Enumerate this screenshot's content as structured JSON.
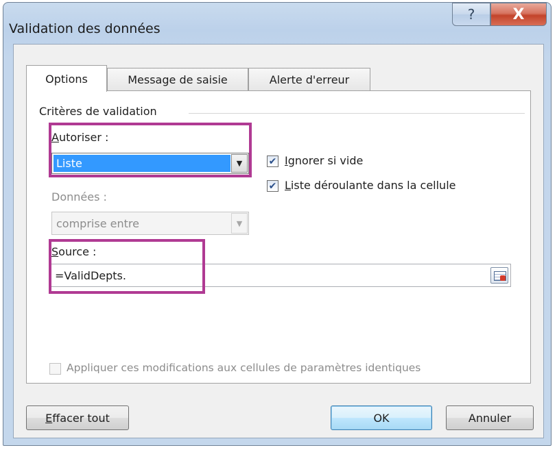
{
  "window": {
    "title": "Validation des données",
    "help_icon": "?",
    "close_icon": "X"
  },
  "tabs": [
    {
      "label": "Options",
      "active": true
    },
    {
      "label": "Message de saisie",
      "active": false
    },
    {
      "label": "Alerte d'erreur",
      "active": false
    }
  ],
  "criteria": {
    "group_label": "Critères de validation",
    "allow": {
      "label_accel": "A",
      "label_rest": "utoriser :",
      "value": "Liste"
    },
    "data": {
      "label": "Données :",
      "value": "comprise entre",
      "enabled": false
    },
    "ignore_blank": {
      "label_accel": "I",
      "label_rest": "gnorer si vide",
      "checked": true
    },
    "in_cell_dropdown": {
      "label_accel": "L",
      "label_rest": "iste déroulante dans la cellule",
      "checked": true
    },
    "source": {
      "label_accel": "S",
      "label_rest": "ource :",
      "value": "=ValidDepts."
    }
  },
  "apply_all": {
    "label": "Appliquer ces modifications aux cellules de paramètres identiques",
    "checked": false,
    "enabled": false
  },
  "buttons": {
    "clear_accel": "E",
    "clear_rest": "ffacer tout",
    "ok": "OK",
    "cancel": "Annuler"
  },
  "icons": {
    "check": "✔",
    "dropdown_arrow": "▼",
    "help": "question-mark-icon",
    "close": "close-icon",
    "range_selector": "collapse-dialog-icon"
  },
  "colors": {
    "highlight": "#b03a93",
    "selection": "#3399ff",
    "close_button": "#c3442b"
  }
}
